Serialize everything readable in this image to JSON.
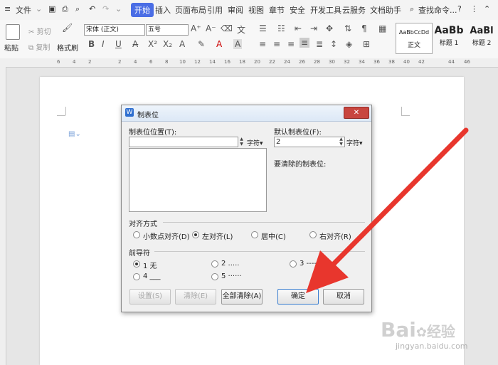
{
  "menubar": {
    "file_label": "文件",
    "tabs": [
      "开始",
      "插入",
      "页面布局",
      "引用",
      "审阅",
      "视图",
      "章节",
      "安全",
      "开发工具",
      "云服务",
      "文档助手"
    ],
    "active_tab": "开始",
    "search_placeholder": "查找命令...",
    "help": "?"
  },
  "ribbon": {
    "paste": "粘贴",
    "cut": "剪切",
    "copy": "复制",
    "format_painter": "格式刷",
    "font_name": "宋体 (正文)",
    "font_size": "五号",
    "styles": [
      {
        "preview": "AaBbCcDd",
        "name": "正文"
      },
      {
        "preview": "AaBb",
        "name": "标题 1"
      },
      {
        "preview": "AaBl",
        "name": "标题 2"
      }
    ]
  },
  "ruler": {
    "ticks": [
      "6",
      "4",
      "2",
      "2",
      "4",
      "6",
      "8",
      "10",
      "12",
      "14",
      "16",
      "18",
      "20",
      "22",
      "24",
      "26",
      "28",
      "30",
      "32",
      "34",
      "36",
      "38",
      "40",
      "42",
      "44",
      "46"
    ]
  },
  "dialog": {
    "title": "制表位",
    "tab_position_label": "制表位位置(T):",
    "tab_position_value": "",
    "unit_label": "字符",
    "default_tab_label": "默认制表位(F):",
    "default_tab_value": "2",
    "default_unit_label": "字符",
    "to_clear_label": "要清除的制表位:",
    "alignment_heading": "对齐方式",
    "alignment_options": [
      "小数点对齐(D)",
      "左对齐(L)",
      "居中(C)",
      "右对齐(R)"
    ],
    "alignment_selected": "左对齐(L)",
    "leader_heading": "前导符",
    "leader_options": [
      "1 无",
      "2 .....",
      "3 -----",
      "4 ___",
      "5 ······"
    ],
    "leader_selected": "1 无",
    "set_button": "设置(S)",
    "clear_button": "清除(E)",
    "clear_all_button": "全部清除(A)",
    "ok_button": "确定",
    "cancel_button": "取消"
  },
  "watermark": {
    "text1": "Bai",
    "text2": "经验",
    "text3": "jingyan.baidu.com"
  },
  "colors": {
    "accent": "#4a6de5",
    "arrow": "#e8362d"
  }
}
